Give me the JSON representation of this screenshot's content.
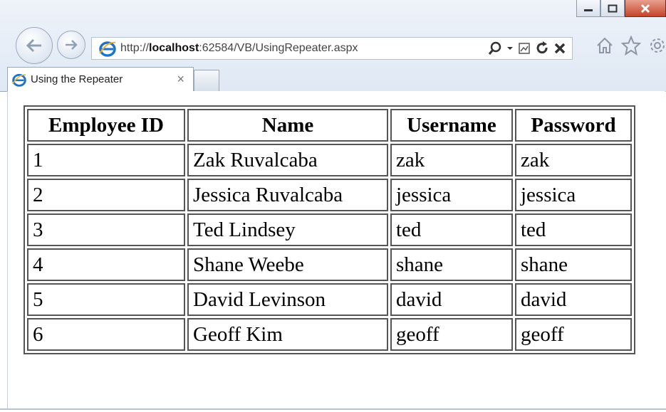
{
  "browser": {
    "url_prefix": "http://",
    "url_host": "localhost",
    "url_rest": ":62584/VB/UsingRepeater.aspx",
    "tab_title": "Using the Repeater",
    "tab_close": "×",
    "colors": {
      "ie_blue": "#1e73c8",
      "close_red": "#c3442b"
    }
  },
  "table": {
    "headers": [
      "Employee ID",
      "Name",
      "Username",
      "Password"
    ],
    "rows": [
      [
        "1",
        "Zak Ruvalcaba",
        "zak",
        "zak"
      ],
      [
        "2",
        "Jessica Ruvalcaba",
        "jessica",
        "jessica"
      ],
      [
        "3",
        "Ted Lindsey",
        "ted",
        "ted"
      ],
      [
        "4",
        "Shane Weebe",
        "shane",
        "shane"
      ],
      [
        "5",
        "David Levinson",
        "david",
        "david"
      ],
      [
        "6",
        "Geoff Kim",
        "geoff",
        "geoff"
      ]
    ]
  }
}
